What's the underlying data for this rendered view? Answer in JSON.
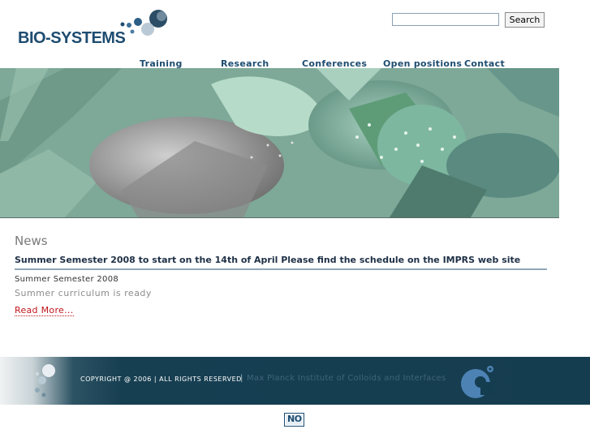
{
  "brand": {
    "name": "BIO-SYSTEMS"
  },
  "search": {
    "placeholder": "",
    "button_label": "Search"
  },
  "nav": {
    "items": [
      {
        "label": "Training",
        "color": "#e8782a"
      },
      {
        "label": "Research",
        "color": "#2f8a35"
      },
      {
        "label": "Conferences",
        "color": "#5a2b7e"
      },
      {
        "label": "Open positions",
        "color": "#1b4e66"
      },
      {
        "label": "Contact",
        "color": "#8f9395"
      }
    ]
  },
  "news": {
    "title": "News",
    "headline": "Summer Semester 2008 to start on the 14th of April Please find the schedule on the IMPRS web site",
    "subtitle": "Summer Semester 2008",
    "summary": "Summer curriculum is ready",
    "read_more": "Read More..."
  },
  "footer": {
    "copyright": "COPYRIGHT @ 2006 | ALL RIGHTS RESERVED",
    "separator": "|",
    "institute": "Max Planck Institute of Colloids and Interfaces"
  },
  "badge": {
    "text": "NO"
  },
  "colors": {
    "brand_blue": "#1e4c70",
    "link_red": "#c0151b",
    "footer_bg": "#153d50"
  }
}
